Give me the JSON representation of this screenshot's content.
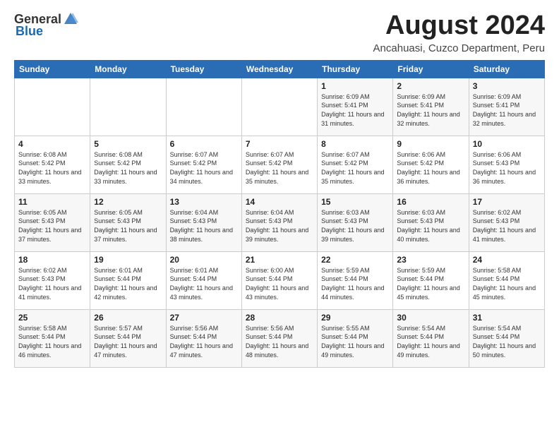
{
  "logo": {
    "general": "General",
    "blue": "Blue"
  },
  "title": "August 2024",
  "location": "Ancahuasi, Cuzco Department, Peru",
  "weekdays": [
    "Sunday",
    "Monday",
    "Tuesday",
    "Wednesday",
    "Thursday",
    "Friday",
    "Saturday"
  ],
  "weeks": [
    [
      {
        "day": "",
        "detail": ""
      },
      {
        "day": "",
        "detail": ""
      },
      {
        "day": "",
        "detail": ""
      },
      {
        "day": "",
        "detail": ""
      },
      {
        "day": "1",
        "detail": "Sunrise: 6:09 AM\nSunset: 5:41 PM\nDaylight: 11 hours\nand 31 minutes."
      },
      {
        "day": "2",
        "detail": "Sunrise: 6:09 AM\nSunset: 5:41 PM\nDaylight: 11 hours\nand 32 minutes."
      },
      {
        "day": "3",
        "detail": "Sunrise: 6:09 AM\nSunset: 5:41 PM\nDaylight: 11 hours\nand 32 minutes."
      }
    ],
    [
      {
        "day": "4",
        "detail": "Sunrise: 6:08 AM\nSunset: 5:42 PM\nDaylight: 11 hours\nand 33 minutes."
      },
      {
        "day": "5",
        "detail": "Sunrise: 6:08 AM\nSunset: 5:42 PM\nDaylight: 11 hours\nand 33 minutes."
      },
      {
        "day": "6",
        "detail": "Sunrise: 6:07 AM\nSunset: 5:42 PM\nDaylight: 11 hours\nand 34 minutes."
      },
      {
        "day": "7",
        "detail": "Sunrise: 6:07 AM\nSunset: 5:42 PM\nDaylight: 11 hours\nand 35 minutes."
      },
      {
        "day": "8",
        "detail": "Sunrise: 6:07 AM\nSunset: 5:42 PM\nDaylight: 11 hours\nand 35 minutes."
      },
      {
        "day": "9",
        "detail": "Sunrise: 6:06 AM\nSunset: 5:42 PM\nDaylight: 11 hours\nand 36 minutes."
      },
      {
        "day": "10",
        "detail": "Sunrise: 6:06 AM\nSunset: 5:43 PM\nDaylight: 11 hours\nand 36 minutes."
      }
    ],
    [
      {
        "day": "11",
        "detail": "Sunrise: 6:05 AM\nSunset: 5:43 PM\nDaylight: 11 hours\nand 37 minutes."
      },
      {
        "day": "12",
        "detail": "Sunrise: 6:05 AM\nSunset: 5:43 PM\nDaylight: 11 hours\nand 37 minutes."
      },
      {
        "day": "13",
        "detail": "Sunrise: 6:04 AM\nSunset: 5:43 PM\nDaylight: 11 hours\nand 38 minutes."
      },
      {
        "day": "14",
        "detail": "Sunrise: 6:04 AM\nSunset: 5:43 PM\nDaylight: 11 hours\nand 39 minutes."
      },
      {
        "day": "15",
        "detail": "Sunrise: 6:03 AM\nSunset: 5:43 PM\nDaylight: 11 hours\nand 39 minutes."
      },
      {
        "day": "16",
        "detail": "Sunrise: 6:03 AM\nSunset: 5:43 PM\nDaylight: 11 hours\nand 40 minutes."
      },
      {
        "day": "17",
        "detail": "Sunrise: 6:02 AM\nSunset: 5:43 PM\nDaylight: 11 hours\nand 41 minutes."
      }
    ],
    [
      {
        "day": "18",
        "detail": "Sunrise: 6:02 AM\nSunset: 5:43 PM\nDaylight: 11 hours\nand 41 minutes."
      },
      {
        "day": "19",
        "detail": "Sunrise: 6:01 AM\nSunset: 5:44 PM\nDaylight: 11 hours\nand 42 minutes."
      },
      {
        "day": "20",
        "detail": "Sunrise: 6:01 AM\nSunset: 5:44 PM\nDaylight: 11 hours\nand 43 minutes."
      },
      {
        "day": "21",
        "detail": "Sunrise: 6:00 AM\nSunset: 5:44 PM\nDaylight: 11 hours\nand 43 minutes."
      },
      {
        "day": "22",
        "detail": "Sunrise: 5:59 AM\nSunset: 5:44 PM\nDaylight: 11 hours\nand 44 minutes."
      },
      {
        "day": "23",
        "detail": "Sunrise: 5:59 AM\nSunset: 5:44 PM\nDaylight: 11 hours\nand 45 minutes."
      },
      {
        "day": "24",
        "detail": "Sunrise: 5:58 AM\nSunset: 5:44 PM\nDaylight: 11 hours\nand 45 minutes."
      }
    ],
    [
      {
        "day": "25",
        "detail": "Sunrise: 5:58 AM\nSunset: 5:44 PM\nDaylight: 11 hours\nand 46 minutes."
      },
      {
        "day": "26",
        "detail": "Sunrise: 5:57 AM\nSunset: 5:44 PM\nDaylight: 11 hours\nand 47 minutes."
      },
      {
        "day": "27",
        "detail": "Sunrise: 5:56 AM\nSunset: 5:44 PM\nDaylight: 11 hours\nand 47 minutes."
      },
      {
        "day": "28",
        "detail": "Sunrise: 5:56 AM\nSunset: 5:44 PM\nDaylight: 11 hours\nand 48 minutes."
      },
      {
        "day": "29",
        "detail": "Sunrise: 5:55 AM\nSunset: 5:44 PM\nDaylight: 11 hours\nand 49 minutes."
      },
      {
        "day": "30",
        "detail": "Sunrise: 5:54 AM\nSunset: 5:44 PM\nDaylight: 11 hours\nand 49 minutes."
      },
      {
        "day": "31",
        "detail": "Sunrise: 5:54 AM\nSunset: 5:44 PM\nDaylight: 11 hours\nand 50 minutes."
      }
    ]
  ]
}
